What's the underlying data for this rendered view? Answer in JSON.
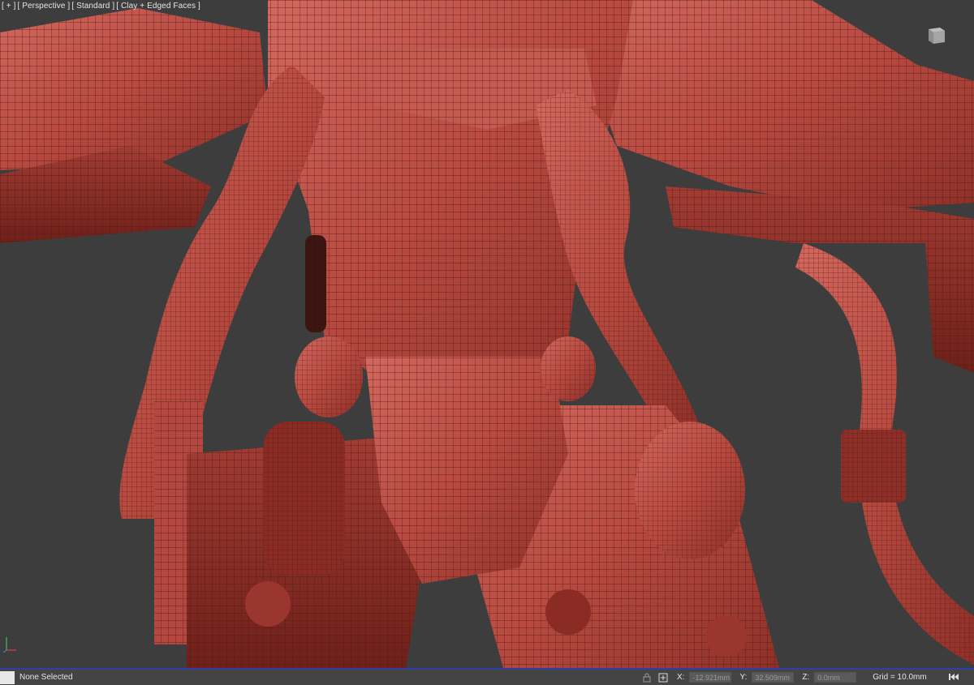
{
  "viewport": {
    "labels": [
      "[ + ]",
      "[ Perspective ]",
      "[ Standard ]",
      "[ Clay + Edged Faces ]"
    ]
  },
  "status": {
    "selection_text": "None Selected",
    "x_label": "X:",
    "x_value": "-12.921mm",
    "y_label": "Y:",
    "y_value": "32.509mm",
    "z_label": "Z:",
    "z_value": "0.0mm",
    "grid_text": "Grid = 10.0mm"
  },
  "colors": {
    "viewport_bg": "#3d3d3d",
    "mesh_red": "#b8483f",
    "status_accent": "#2f3fa8"
  },
  "icons": [
    "viewcube-icon",
    "axis-gizmo-icon",
    "lock-icon",
    "absolute-mode-icon",
    "go-to-start-icon"
  ]
}
